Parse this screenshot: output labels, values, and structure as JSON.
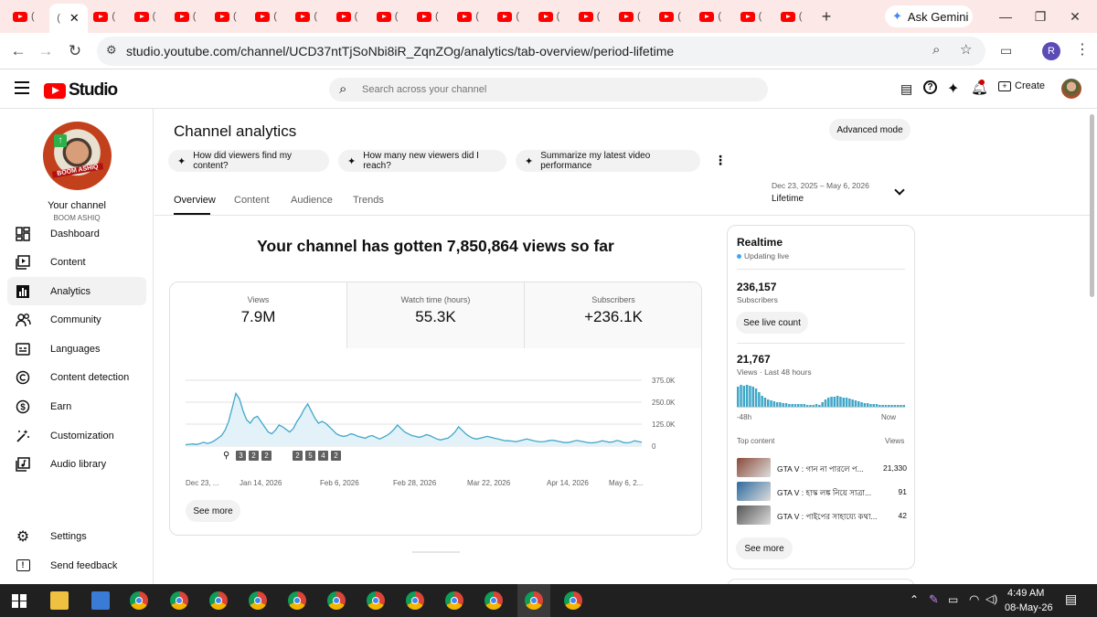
{
  "browser": {
    "tab_count": 20,
    "ask_gemini": "Ask Gemini",
    "url": "studio.youtube.com/channel/UCD37ntTjSoNbi8iR_ZqnZOg/analytics/tab-overview/period-lifetime"
  },
  "studio": {
    "brand": "Studio",
    "search_placeholder": "Search across your channel",
    "create_label": "Create"
  },
  "sidebar": {
    "avatar_caption": "BOOM ASHIQ",
    "your_channel": "Your channel",
    "channel_name": "BOOM ASHIQ",
    "items": [
      {
        "label": "Dashboard",
        "icon": "dashboard-icon"
      },
      {
        "label": "Content",
        "icon": "content-icon"
      },
      {
        "label": "Analytics",
        "icon": "analytics-icon",
        "active": true
      },
      {
        "label": "Community",
        "icon": "community-icon"
      },
      {
        "label": "Languages",
        "icon": "languages-icon"
      },
      {
        "label": "Content detection",
        "icon": "copyright-icon"
      },
      {
        "label": "Earn",
        "icon": "dollar-icon"
      },
      {
        "label": "Customization",
        "icon": "magic-wand-icon"
      },
      {
        "label": "Audio library",
        "icon": "audio-library-icon"
      }
    ],
    "settings": "Settings",
    "feedback": "Send feedback"
  },
  "main": {
    "title": "Channel analytics",
    "advanced_mode": "Advanced mode",
    "chips": [
      "How did viewers find my content?",
      "How many new viewers did I reach?",
      "Summarize my latest video performance"
    ],
    "tabs": [
      "Overview",
      "Content",
      "Audience",
      "Trends"
    ],
    "active_tab": "Overview",
    "date_range": "Dec 23, 2025 – May 6, 2026",
    "period": "Lifetime",
    "headline": "Your channel has gotten 7,850,864 views so far",
    "metrics": [
      {
        "label": "Views",
        "value": "7.9M"
      },
      {
        "label": "Watch time (hours)",
        "value": "55.3K"
      },
      {
        "label": "Subscribers",
        "value": "+236.1K"
      }
    ],
    "see_more": "See more",
    "markers": [
      "3",
      "2",
      "2",
      "2",
      "5",
      "4",
      "2"
    ]
  },
  "chart_data": {
    "type": "line",
    "x_tick_labels": [
      "Dec 23, ...",
      "Jan 14, 2026",
      "Feb 6, 2026",
      "Feb 28, 2026",
      "Mar 22, 2026",
      "Apr 14, 2026",
      "May 6, 2..."
    ],
    "y_tick_labels": [
      "375.0K",
      "250.0K",
      "125.0K",
      "0"
    ],
    "ylim": [
      0,
      375000
    ],
    "grid": true,
    "series": [
      {
        "color": "#41a7c9",
        "values": [
          8000,
          10000,
          12000,
          9000,
          14000,
          22000,
          15000,
          20000,
          30000,
          45000,
          60000,
          90000,
          140000,
          220000,
          300000,
          270000,
          200000,
          150000,
          130000,
          160000,
          170000,
          140000,
          110000,
          80000,
          70000,
          90000,
          120000,
          110000,
          95000,
          80000,
          100000,
          140000,
          170000,
          210000,
          240000,
          200000,
          160000,
          130000,
          140000,
          130000,
          110000,
          90000,
          70000,
          60000,
          55000,
          60000,
          70000,
          65000,
          55000,
          50000,
          45000,
          55000,
          60000,
          50000,
          40000,
          50000,
          60000,
          75000,
          95000,
          120000,
          100000,
          80000,
          70000,
          60000,
          55000,
          50000,
          55000,
          65000,
          60000,
          50000,
          40000,
          35000,
          40000,
          45000,
          60000,
          80000,
          110000,
          90000,
          70000,
          55000,
          45000,
          40000,
          45000,
          50000,
          55000,
          50000,
          45000,
          40000,
          35000,
          30000,
          30000,
          28000,
          25000,
          30000,
          35000,
          40000,
          35000,
          30000,
          26000,
          24000,
          26000,
          30000,
          34000,
          30000,
          26000,
          22000,
          20000,
          22000,
          28000,
          32000,
          28000,
          24000,
          20000,
          18000,
          20000,
          24000,
          30000,
          26000,
          22000,
          24000,
          32000,
          28000,
          20000,
          18000,
          22000,
          30000,
          26000,
          22000
        ]
      }
    ]
  },
  "realtime": {
    "title": "Realtime",
    "updating": "Updating live",
    "subscribers_value": "236,157",
    "subscribers_label": "Subscribers",
    "see_live_count": "See live count",
    "views_value": "21,767",
    "views_label": "Views · Last 48 hours",
    "bars": [
      22,
      24,
      23,
      24,
      23,
      22,
      20,
      16,
      12,
      10,
      8,
      7,
      6,
      5,
      5,
      4,
      4,
      3,
      3,
      3,
      3,
      3,
      3,
      2,
      2,
      2,
      3,
      2,
      5,
      8,
      10,
      11,
      11,
      12,
      11,
      10,
      10,
      9,
      8,
      7,
      6,
      5,
      4,
      4,
      3,
      3,
      3,
      2,
      2,
      2,
      2,
      2,
      2,
      2,
      2,
      2
    ],
    "axis_left": "-48h",
    "axis_right": "Now",
    "top_content": "Top content",
    "views_col": "Views",
    "rows": [
      {
        "title": "GTA V : গান না পারলে প...",
        "views": "21,330"
      },
      {
        "title": "GTA V : হাস্ক লঙ্ক নিয়ে সাত্রা...",
        "views": "91"
      },
      {
        "title": "GTA V : পাইপের সাহায্যে কথা...",
        "views": "42"
      }
    ],
    "see_more": "See more"
  },
  "taskbar": {
    "time": "4:49 AM",
    "date": "08-May-26"
  }
}
